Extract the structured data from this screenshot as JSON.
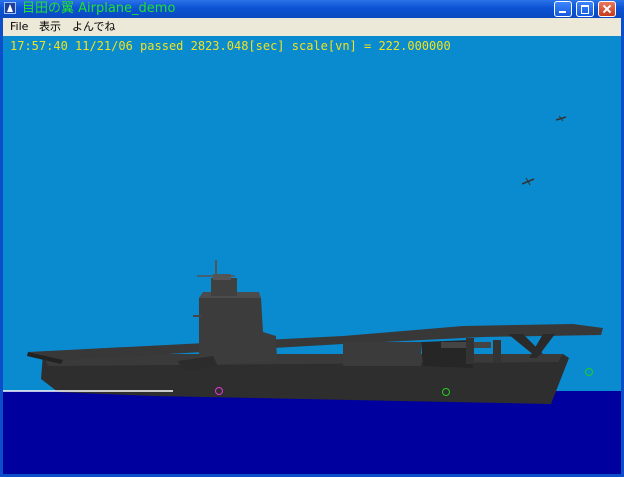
{
  "window": {
    "title": "目田の翼 Airplane_demo",
    "buttons": [
      "minimize",
      "maximize",
      "close"
    ]
  },
  "menu": {
    "items": [
      "File",
      "表示",
      "よんでね"
    ]
  },
  "hud": {
    "status": "17:57:40 11/21/06 passed 2823.048[sec] scale[vn] = 222.000000"
  },
  "colors": {
    "sky": "#0a8bd0",
    "sea": "#00009e",
    "hud_text": "#f0e21e",
    "title_text": "#21e02f",
    "ship": "#2b2b2b"
  }
}
